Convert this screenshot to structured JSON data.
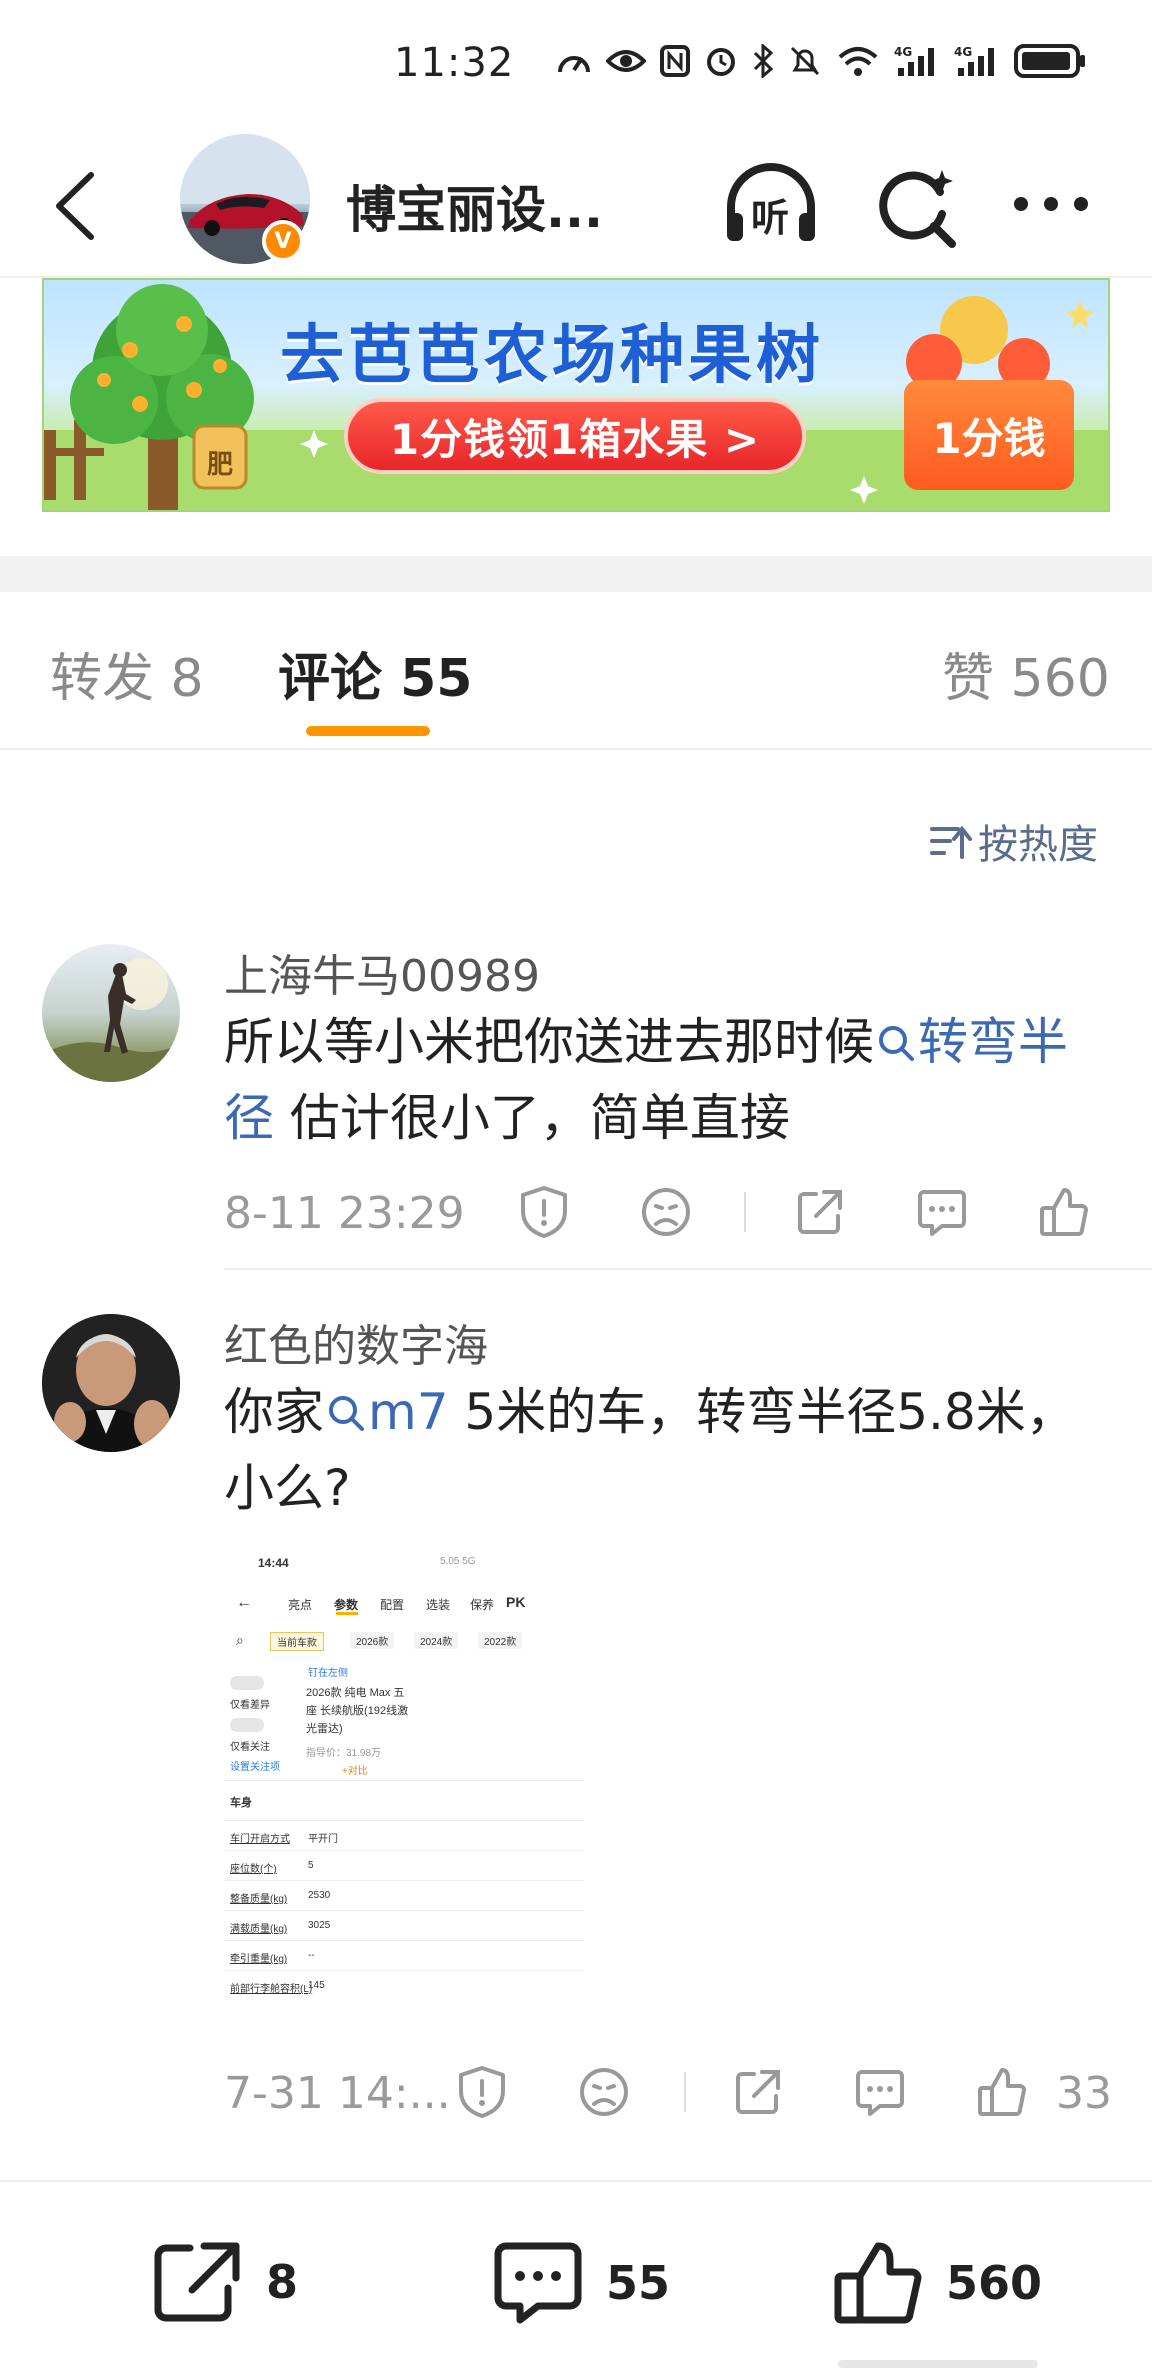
{
  "status_bar": {
    "time": "11:32"
  },
  "nav": {
    "title": "博宝丽设...",
    "verified_badge": "V"
  },
  "banner": {
    "title": "去芭芭农场种果树",
    "cta": "1分钱领1箱水果 >",
    "box_label": "1分钱",
    "fertilizer_label": "肥"
  },
  "tabs": {
    "repost": "转发 8",
    "comments": "评论 55",
    "likes": "赞 560"
  },
  "sort": {
    "label": "按热度"
  },
  "comments": [
    {
      "name": "上海牛马00989",
      "text_part1": "所以等小米把你送进去那时候",
      "topic": "转弯半径",
      "text_part2": " 估计很小了，简单直接",
      "time": "8-11 23:29"
    },
    {
      "name": "红色的数字海",
      "text_part1": "你家",
      "topic": "m7",
      "text_part2": "  5米的车，转弯半径5.8米，小么?",
      "time": "7-31 14:...",
      "like_count": "33"
    }
  ],
  "comment_image": {
    "status_time": "14:44",
    "status_right": "5.05 5G",
    "tabs": [
      "亮点",
      "参数",
      "配置",
      "选装",
      "保养"
    ],
    "pk": "PK",
    "year_tabs": [
      "当前车款",
      "2026款",
      "2024款",
      "2022款"
    ],
    "pin_left": "钉在左侧",
    "filter1": "仅看差异",
    "filter2": "仅看关注",
    "settings": "设置关注项",
    "model_name_l1": "2026款 纯电 Max 五",
    "model_name_l2": "座 长续航版(192线激",
    "model_name_l3": "光雷达)",
    "guide_price": "指导价：31.98万",
    "compare": "+对比",
    "section": "车身",
    "rows": [
      {
        "label": "车门开启方式",
        "value": "平开门"
      },
      {
        "label": "座位数(个)",
        "value": "5"
      },
      {
        "label": "整备质量(kg)",
        "value": "2530"
      },
      {
        "label": "满载质量(kg)",
        "value": "3025"
      },
      {
        "label": "牵引重量(kg)",
        "value": "--"
      },
      {
        "label": "前部行李舱容积(L)",
        "value": "145"
      }
    ]
  },
  "bottom_bar": {
    "repost_count": "8",
    "comment_count": "55",
    "like_count": "560"
  },
  "colors": {
    "accent": "#ff9500",
    "link": "#3b69b5",
    "banner_title": "#1e5fd6"
  }
}
